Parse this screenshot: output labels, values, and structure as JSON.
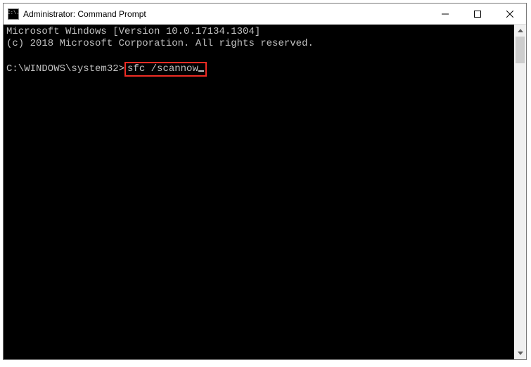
{
  "window": {
    "title": "Administrator: Command Prompt",
    "icon_glyph": "C:\\."
  },
  "terminal": {
    "line1": "Microsoft Windows [Version 10.0.17134.1304]",
    "line2": "(c) 2018 Microsoft Corporation. All rights reserved.",
    "prompt": "C:\\WINDOWS\\system32>",
    "command": "sfc /scannow"
  }
}
